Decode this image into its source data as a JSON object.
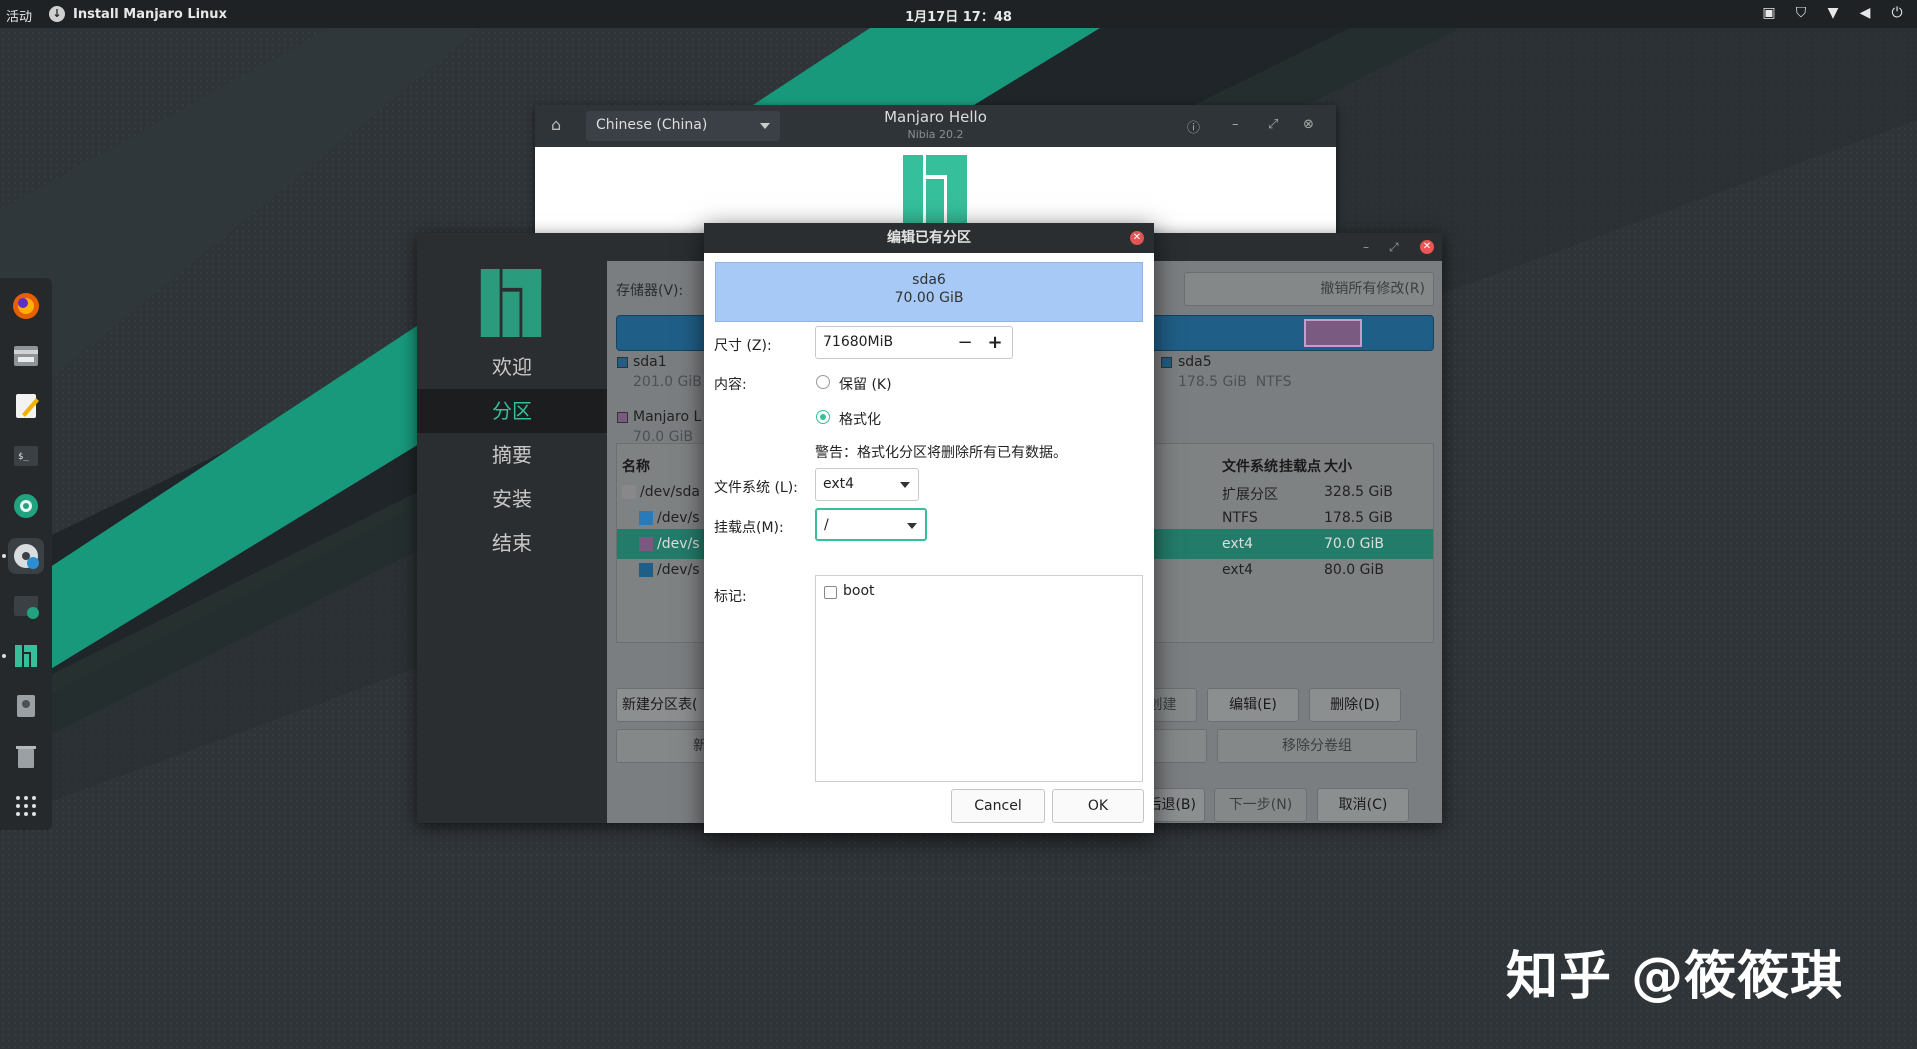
{
  "topbar": {
    "activities": "活动",
    "app_indicator": "Install Manjaro Linux",
    "clock": "1月17日 17：48",
    "tray_icons": [
      "screen-icon",
      "shield-icon",
      "wifi-icon",
      "volume-icon",
      "power-icon"
    ]
  },
  "dock": {
    "items": [
      "firefox-icon",
      "files-icon",
      "text-editor-icon",
      "terminal-icon",
      "camera-icon",
      "installer-disc-icon",
      "terminal-download-icon",
      "manjaro-hello-icon",
      "disk-icon",
      "trash-icon",
      "app-grid-icon"
    ]
  },
  "hello": {
    "language": "Chinese (China)",
    "title": "Manjaro Hello",
    "subtitle": "Nibia 20.2"
  },
  "installer": {
    "sidebar": [
      "欢迎",
      "分区",
      "摘要",
      "安装",
      "结束"
    ],
    "active_index": 1,
    "storage_label": "存储器(V):",
    "revert_button": "撤销所有修改(R)",
    "legend": [
      {
        "name": "sda1",
        "info": "201.0 GiB",
        "color": "#1f5e86"
      },
      {
        "name": "sda5",
        "info": "178.5 GiB  NTFS",
        "color": "#1f5e86"
      },
      {
        "name": "Manjaro L",
        "info": "70.0 GiB",
        "color": "#7a5a80"
      }
    ],
    "headers": {
      "name": "名称",
      "fs": "文件系统",
      "mount": "挂载点",
      "size": "大小"
    },
    "rows": [
      {
        "name": "/dev/sda",
        "fs": "扩展分区",
        "size": "328.5 GiB",
        "color": "#888888",
        "indent": 0,
        "selected": false
      },
      {
        "name": "/dev/s",
        "fs": "NTFS",
        "size": "178.5 GiB",
        "color": "#2a7ab8",
        "indent": 1,
        "selected": false
      },
      {
        "name": "/dev/s",
        "fs": "ext4",
        "size": "70.0 GiB",
        "color": "#7a5a80",
        "indent": 1,
        "selected": true
      },
      {
        "name": "/dev/s",
        "fs": "ext4",
        "size": "80.0 GiB",
        "color": "#1f5e86",
        "indent": 1,
        "selected": false
      }
    ],
    "new_table_button": "新建分区表(",
    "new_button_partial": "新",
    "create_button": "创建",
    "edit_button": "编辑(E)",
    "delete_button": "删除(D)",
    "volgroup_partial": "组",
    "remove_volgroup_button": "移除分卷组",
    "back_button_partial": "后退(B)",
    "next_button": "下一步(N)",
    "cancel_button": "取消(C)"
  },
  "dialog": {
    "title": "编辑已有分区",
    "partition_name": "sda6",
    "partition_size": "70.00 GiB",
    "size_label": "尺寸 (Z):",
    "size_value": "71680MiB",
    "content_label": "内容:",
    "keep_label": "保留 (K)",
    "format_label": "格式化",
    "format_selected": true,
    "warning": "警告：格式化分区将删除所有已有数据。",
    "fs_label": "文件系统 (L):",
    "fs_value": "ext4",
    "mount_label": "挂载点(M):",
    "mount_value": "/",
    "flags_label": "标记:",
    "flags": [
      {
        "label": "boot",
        "checked": false
      }
    ],
    "cancel": "Cancel",
    "ok": "OK"
  },
  "watermark": "知乎 @筱筱琪",
  "colors": {
    "accent": "#35bf9a",
    "selection": "#237b6a",
    "partition_blue": "#a7c9f6"
  }
}
